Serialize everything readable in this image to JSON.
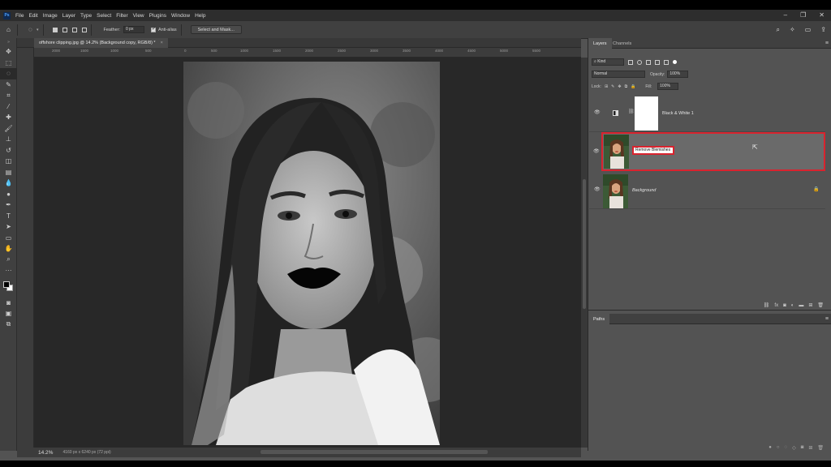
{
  "menubar": {
    "logo": "Ps",
    "items": [
      "File",
      "Edit",
      "Image",
      "Layer",
      "Type",
      "Select",
      "Filter",
      "View",
      "Plugins",
      "Window",
      "Help"
    ]
  },
  "window_controls": {
    "minimize": "–",
    "restore": "❐",
    "close": "✕"
  },
  "options": {
    "feather_label": "Feather:",
    "feather_value": "0 px",
    "antialias_label": "Anti-alias",
    "select_mask_label": "Select and Mask..."
  },
  "document": {
    "tab_title": "offshore clipping.jpg @ 14.2% (Background copy, RGB/8) *",
    "tab_close": "×",
    "ruler_marks": [
      "2000",
      "1500",
      "1000",
      "500",
      "0",
      "500",
      "1000",
      "1500",
      "2000",
      "2500",
      "3000",
      "3500",
      "4000",
      "4500",
      "5000",
      "5500"
    ],
    "zoom": "14.2%",
    "info": "4160 px x 6240 px (72 ppi)"
  },
  "layers_panel": {
    "tabs": [
      "Layers",
      "Channels"
    ],
    "kind_label": "Kind",
    "blend_mode": "Normal",
    "opacity_label": "Opacity:",
    "opacity_value": "100%",
    "lock_label": "Lock:",
    "fill_label": "Fill:",
    "fill_value": "100%",
    "layers": [
      {
        "name": "Black & White 1",
        "type": "adjustment"
      },
      {
        "name": "Remove Blemishes",
        "type": "image",
        "selected": true
      },
      {
        "name": "Background",
        "type": "image",
        "locked": true
      }
    ],
    "highlight_color": "#d9232e"
  },
  "paths_panel": {
    "tab": "Paths"
  }
}
